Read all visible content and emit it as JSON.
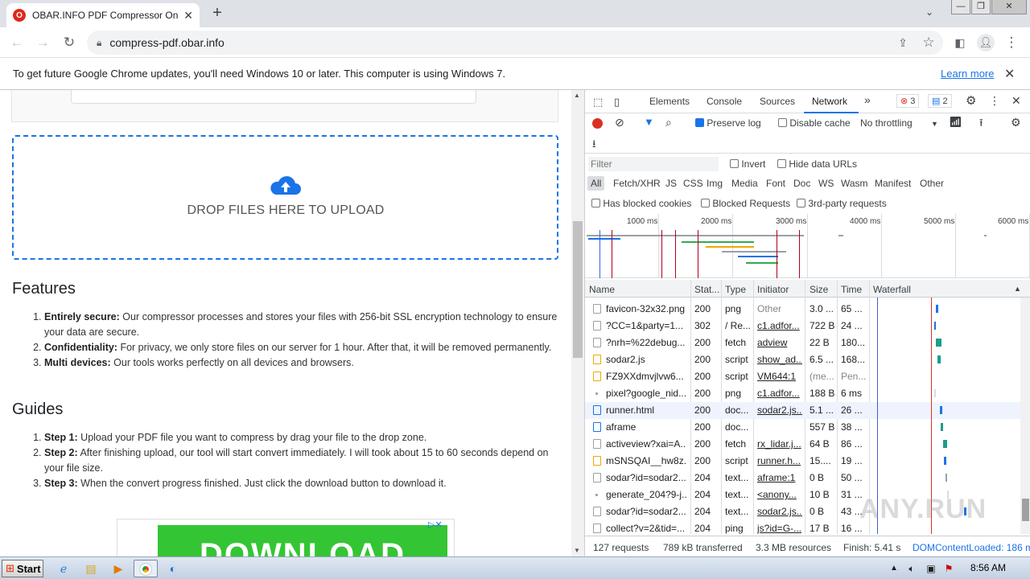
{
  "browser": {
    "tab_title": "OBAR.INFO PDF Compressor Online",
    "tab_favicon": "O",
    "new_tab": "+",
    "url": "compress-pdf.obar.info"
  },
  "infobar": {
    "message": "To get future Google Chrome updates, you'll need Windows 10 or later. This computer is using Windows 7.",
    "learn_more": "Learn more"
  },
  "page": {
    "drop_text": "DROP FILES HERE TO UPLOAD",
    "features_title": "Features",
    "features": [
      {
        "bold": "Entirely secure:",
        "text": " Our compressor processes and stores your files with 256-bit SSL encryption technology to ensure your data are secure."
      },
      {
        "bold": "Confidentiality:",
        "text": " For privacy, we only store files on our server for 1 hour. After that, it will be removed permanently."
      },
      {
        "bold": "Multi devices:",
        "text": " Our tools works perfectly on all devices and browsers."
      }
    ],
    "guides_title": "Guides",
    "guides": [
      {
        "bold": "Step 1:",
        "text": " Upload your PDF file you want to compress by drag your file to the drop zone."
      },
      {
        "bold": "Step 2:",
        "text": " After finishing upload, our tool will start convert immediately. I will took about 15 to 60 seconds depend on your file size."
      },
      {
        "bold": "Step 3:",
        "text": " When the convert progress finished. Just click the download button to download it."
      }
    ],
    "ad_text": "DOWNLOAD"
  },
  "devtools": {
    "tabs": [
      "Elements",
      "Console",
      "Sources",
      "Network"
    ],
    "more": "»",
    "errors": "3",
    "messages": "2",
    "preserve_log": "Preserve log",
    "disable_cache": "Disable cache",
    "throttling": "No throttling",
    "filter_placeholder": "Filter",
    "invert": "Invert",
    "hide_data_urls": "Hide data URLs",
    "type_filters": [
      "All",
      "Fetch/XHR",
      "JS",
      "CSS",
      "Img",
      "Media",
      "Font",
      "Doc",
      "WS",
      "Wasm",
      "Manifest",
      "Other"
    ],
    "has_blocked_cookies": "Has blocked cookies",
    "blocked_requests": "Blocked Requests",
    "third_party": "3rd-party requests",
    "timeline_ticks": [
      "1000 ms",
      "2000 ms",
      "3000 ms",
      "4000 ms",
      "5000 ms",
      "6000 ms"
    ],
    "columns": [
      "Name",
      "Stat...",
      "Type",
      "Initiator",
      "Size",
      "Time",
      "Waterfall"
    ],
    "rows": [
      {
        "name": "favicon-32x32.png",
        "status": "200",
        "type": "png",
        "initiator": "Other",
        "size": "3.0 ...",
        "time": "65 ...",
        "icon": "img"
      },
      {
        "name": "?CC=1&party=1...",
        "status": "302",
        "type": "/ Re...",
        "initiator": "c1.adfor...",
        "size": "722 B",
        "time": "24 ...",
        "icon": "img"
      },
      {
        "name": "?nrh=%22debug...",
        "status": "200",
        "type": "fetch",
        "initiator": "adview",
        "size": "22 B",
        "time": "180...",
        "icon": "img"
      },
      {
        "name": "sodar2.js",
        "status": "200",
        "type": "script",
        "initiator": "show_ad...",
        "size": "6.5 ...",
        "time": "168...",
        "icon": "js"
      },
      {
        "name": "FZ9XXdmvjlvw6...",
        "status": "200",
        "type": "script",
        "initiator": "VM644:1",
        "size": "(me...",
        "time": "Pen...",
        "icon": "js"
      },
      {
        "name": "pixel?google_nid...",
        "status": "200",
        "type": "png",
        "initiator": "c1.adfor...",
        "size": "188 B",
        "time": "6 ms",
        "icon": "dot"
      },
      {
        "name": "runner.html",
        "status": "200",
        "type": "doc...",
        "initiator": "sodar2.js...",
        "size": "5.1 ...",
        "time": "26 ...",
        "icon": "doc"
      },
      {
        "name": "aframe",
        "status": "200",
        "type": "doc...",
        "initiator": "",
        "size": "557 B",
        "time": "38 ...",
        "icon": "doc"
      },
      {
        "name": "activeview?xai=A...",
        "status": "200",
        "type": "fetch",
        "initiator": "rx_lidar.j...",
        "size": "64 B",
        "time": "86 ...",
        "icon": "img"
      },
      {
        "name": "mSNSQAI__hw8z...",
        "status": "200",
        "type": "script",
        "initiator": "runner.h...",
        "size": "15....",
        "time": "19 ...",
        "icon": "js"
      },
      {
        "name": "sodar?id=sodar2...",
        "status": "204",
        "type": "text...",
        "initiator": "aframe:1",
        "size": "0 B",
        "time": "50 ...",
        "icon": "img"
      },
      {
        "name": "generate_204?9-j...",
        "status": "204",
        "type": "text...",
        "initiator": "<anony...",
        "size": "10 B",
        "time": "31 ...",
        "icon": "dot"
      },
      {
        "name": "sodar?id=sodar2...",
        "status": "204",
        "type": "text...",
        "initiator": "sodar2.js...",
        "size": "0 B",
        "time": "43 ...",
        "icon": "img"
      },
      {
        "name": "collect?v=2&tid=...",
        "status": "204",
        "type": "ping",
        "initiator": "js?id=G-...",
        "size": "17 B",
        "time": "16 ...",
        "icon": "img"
      }
    ],
    "status": {
      "requests": "127 requests",
      "transferred": "789 kB transferred",
      "resources": "3.3 MB resources",
      "finish": "Finish: 5.41 s",
      "dcl": "DOMContentLoaded: 186 m"
    }
  },
  "taskbar": {
    "start": "Start",
    "time": "8:56 AM"
  },
  "watermark": "ANY.RUN",
  "colors": {
    "accent": "#1a73e8",
    "error": "#d93025",
    "drop_border": "#1a73e8",
    "ad_green": "#34c534"
  }
}
